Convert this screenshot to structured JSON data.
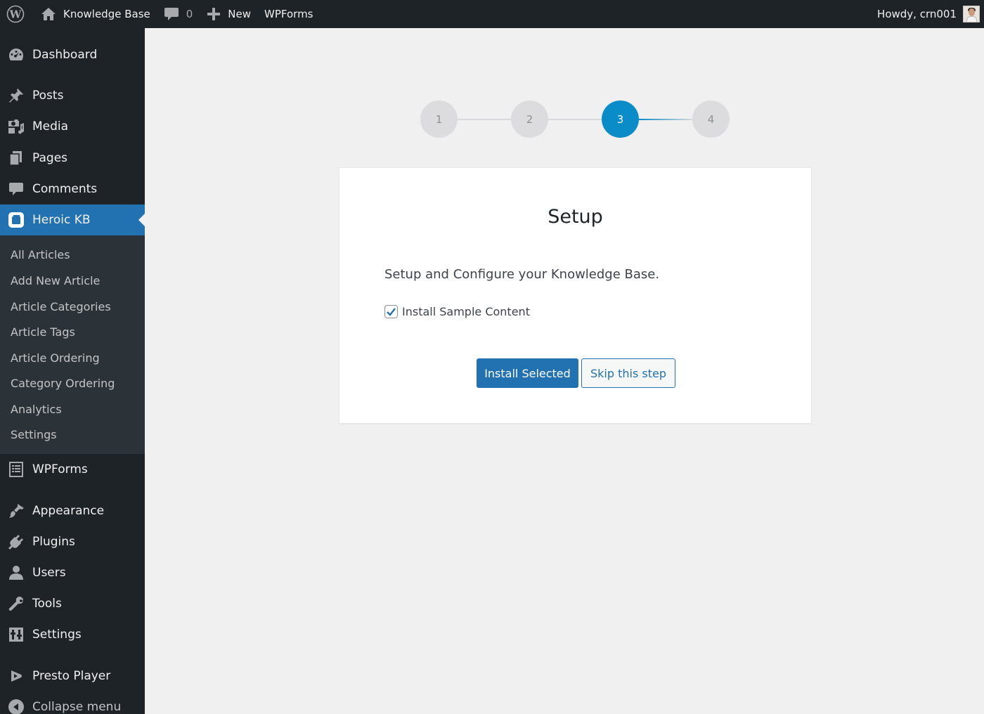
{
  "admin_bar": {
    "site_name": "Knowledge Base",
    "comment_count": "0",
    "new_label": "New",
    "wpforms_label": "WPForms",
    "greeting": "Howdy, crn001"
  },
  "sidebar": {
    "items": {
      "dashboard": "Dashboard",
      "posts": "Posts",
      "media": "Media",
      "pages": "Pages",
      "comments": "Comments",
      "heroic_kb": "Heroic KB",
      "wpforms": "WPForms",
      "appearance": "Appearance",
      "plugins": "Plugins",
      "users": "Users",
      "tools": "Tools",
      "settings": "Settings",
      "presto_player": "Presto Player",
      "collapse": "Collapse menu"
    },
    "submenu": [
      "All Articles",
      "Add New Article",
      "Article Categories",
      "Article Tags",
      "Article Ordering",
      "Category Ordering",
      "Analytics",
      "Settings"
    ],
    "current_item": "Heroic KB"
  },
  "wizard": {
    "steps": [
      "1",
      "2",
      "3",
      "4"
    ],
    "active_step": 3,
    "title": "Setup",
    "description": "Setup and Configure your Knowledge Base.",
    "sample_content_label": "Install Sample Content",
    "sample_content_checked": true,
    "install_button": "Install Selected",
    "skip_button": "Skip this step"
  },
  "colors": {
    "admin_bg": "#1d2327",
    "submenu_bg": "#2c3338",
    "accent": "#2271b1",
    "step_active": "#0a8cc8",
    "page_bg": "#f0f0f1"
  }
}
